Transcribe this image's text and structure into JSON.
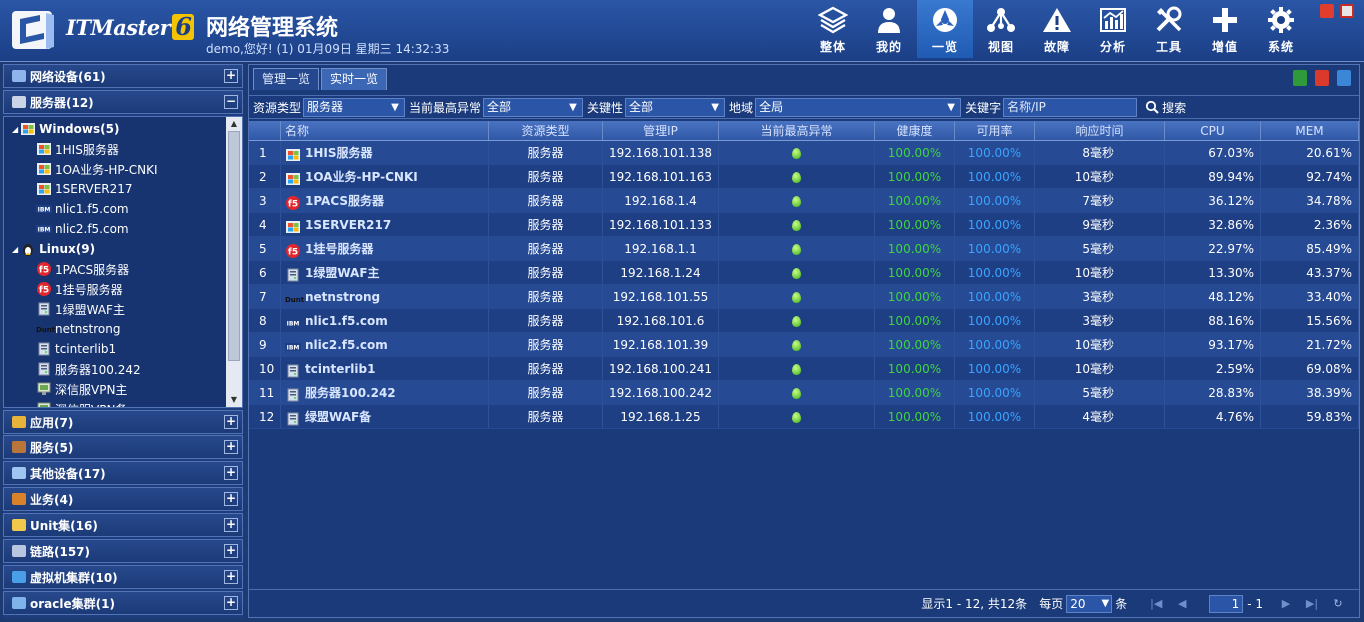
{
  "header": {
    "brand": "ITMaster",
    "brand_version": "6",
    "title": "网络管理系统",
    "greeting": "demo,您好! (1) 01月09日 星期三 14:32:33",
    "nav": [
      {
        "label": "整体",
        "icon": "layers-icon"
      },
      {
        "label": "我的",
        "icon": "user-icon"
      },
      {
        "label": "一览",
        "icon": "dashboard-icon",
        "active": true
      },
      {
        "label": "视图",
        "icon": "topology-icon"
      },
      {
        "label": "故障",
        "icon": "warning-icon"
      },
      {
        "label": "分析",
        "icon": "chart-icon"
      },
      {
        "label": "工具",
        "icon": "tools-icon"
      },
      {
        "label": "增值",
        "icon": "plus-icon"
      },
      {
        "label": "系统",
        "icon": "gear-icon"
      }
    ]
  },
  "sidebar": {
    "categories": [
      {
        "label": "网络设备(61)",
        "toggle": "+"
      },
      {
        "label": "服务器(12)",
        "toggle": "−"
      },
      {
        "label": "应用(7)",
        "toggle": "+"
      },
      {
        "label": "服务(5)",
        "toggle": "+"
      },
      {
        "label": "其他设备(17)",
        "toggle": "+"
      },
      {
        "label": "业务(4)",
        "toggle": "+"
      },
      {
        "label": "Unit集(16)",
        "toggle": "+"
      },
      {
        "label": "链路(157)",
        "toggle": "+"
      },
      {
        "label": "虚拟机集群(10)",
        "toggle": "+"
      },
      {
        "label": "oracle集群(1)",
        "toggle": "+"
      }
    ],
    "tree": [
      {
        "label": "Windows(5)",
        "group": true,
        "icon": "windows-icon"
      },
      {
        "label": "1HIS服务器",
        "icon": "windows-icon"
      },
      {
        "label": "1OA业务-HP-CNKI",
        "icon": "windows-icon"
      },
      {
        "label": "1SERVER217",
        "icon": "windows-icon"
      },
      {
        "label": "nlic1.f5.com",
        "icon": "ibm-icon"
      },
      {
        "label": "nlic2.f5.com",
        "icon": "ibm-icon"
      },
      {
        "label": "Linux(9)",
        "group": true,
        "icon": "linux-icon"
      },
      {
        "label": "1PACS服务器",
        "icon": "f5-icon"
      },
      {
        "label": "1挂号服务器",
        "icon": "f5-icon"
      },
      {
        "label": "1绿盟WAF主",
        "icon": "server-icon"
      },
      {
        "label": "netnstrong",
        "icon": "dunt-icon"
      },
      {
        "label": "tcinterlib1",
        "icon": "server-icon"
      },
      {
        "label": "服务器100.242",
        "icon": "server-icon"
      },
      {
        "label": "深信服VPN主",
        "icon": "monitor-icon"
      },
      {
        "label": "深信服VPN备",
        "icon": "monitor-icon"
      }
    ]
  },
  "tabs": [
    {
      "label": "管理一览"
    },
    {
      "label": "实时一览",
      "active": true
    }
  ],
  "filters": {
    "type_label": "资源类型",
    "type_value": "服务器",
    "abn_label": "当前最高异常",
    "abn_value": "全部",
    "key_label": "关键性",
    "key_value": "全部",
    "region_label": "地域",
    "region_value": "全局",
    "kw_label": "关键字",
    "kw_placeholder": "名称/IP",
    "search_label": "搜索"
  },
  "table": {
    "headers": [
      "",
      "名称",
      "资源类型",
      "管理IP",
      "当前最高异常",
      "健康度",
      "可用率",
      "响应时间",
      "CPU",
      "MEM"
    ],
    "rows": [
      {
        "no": "1",
        "name": "1HIS服务器",
        "icon": "windows-icon",
        "type": "服务器",
        "ip": "192.168.101.138",
        "health": "100.00%",
        "avail": "100.00%",
        "resp": "8毫秒",
        "cpu": "67.03%",
        "mem": "20.61%"
      },
      {
        "no": "2",
        "name": "1OA业务-HP-CNKI",
        "icon": "windows-icon",
        "type": "服务器",
        "ip": "192.168.101.163",
        "health": "100.00%",
        "avail": "100.00%",
        "resp": "10毫秒",
        "cpu": "89.94%",
        "mem": "92.74%"
      },
      {
        "no": "3",
        "name": "1PACS服务器",
        "icon": "f5-icon",
        "type": "服务器",
        "ip": "192.168.1.4",
        "health": "100.00%",
        "avail": "100.00%",
        "resp": "7毫秒",
        "cpu": "36.12%",
        "mem": "34.78%"
      },
      {
        "no": "4",
        "name": "1SERVER217",
        "icon": "windows-icon",
        "type": "服务器",
        "ip": "192.168.101.133",
        "health": "100.00%",
        "avail": "100.00%",
        "resp": "9毫秒",
        "cpu": "32.86%",
        "mem": "2.36%"
      },
      {
        "no": "5",
        "name": "1挂号服务器",
        "icon": "f5-icon",
        "type": "服务器",
        "ip": "192.168.1.1",
        "health": "100.00%",
        "avail": "100.00%",
        "resp": "5毫秒",
        "cpu": "22.97%",
        "mem": "85.49%"
      },
      {
        "no": "6",
        "name": "1绿盟WAF主",
        "icon": "server-icon",
        "type": "服务器",
        "ip": "192.168.1.24",
        "health": "100.00%",
        "avail": "100.00%",
        "resp": "10毫秒",
        "cpu": "13.30%",
        "mem": "43.37%"
      },
      {
        "no": "7",
        "name": "netnstrong",
        "icon": "dunt-icon",
        "type": "服务器",
        "ip": "192.168.101.55",
        "health": "100.00%",
        "avail": "100.00%",
        "resp": "3毫秒",
        "cpu": "48.12%",
        "mem": "33.40%"
      },
      {
        "no": "8",
        "name": "nlic1.f5.com",
        "icon": "ibm-icon",
        "type": "服务器",
        "ip": "192.168.101.6",
        "health": "100.00%",
        "avail": "100.00%",
        "resp": "3毫秒",
        "cpu": "88.16%",
        "mem": "15.56%"
      },
      {
        "no": "9",
        "name": "nlic2.f5.com",
        "icon": "ibm-icon",
        "type": "服务器",
        "ip": "192.168.101.39",
        "health": "100.00%",
        "avail": "100.00%",
        "resp": "10毫秒",
        "cpu": "93.17%",
        "mem": "21.72%"
      },
      {
        "no": "10",
        "name": "tcinterlib1",
        "icon": "server-icon",
        "type": "服务器",
        "ip": "192.168.100.241",
        "health": "100.00%",
        "avail": "100.00%",
        "resp": "10毫秒",
        "cpu": "2.59%",
        "mem": "69.08%"
      },
      {
        "no": "11",
        "name": "服务器100.242",
        "icon": "server-icon",
        "type": "服务器",
        "ip": "192.168.100.242",
        "health": "100.00%",
        "avail": "100.00%",
        "resp": "5毫秒",
        "cpu": "28.83%",
        "mem": "38.39%"
      },
      {
        "no": "12",
        "name": "绿盟WAF备",
        "icon": "server-icon",
        "type": "服务器",
        "ip": "192.168.1.25",
        "health": "100.00%",
        "avail": "100.00%",
        "resp": "4毫秒",
        "cpu": "4.76%",
        "mem": "59.83%"
      }
    ]
  },
  "pager": {
    "summary": "显示1 - 12, 共12条",
    "per_page_label": "每页",
    "per_page": "20",
    "unit": "条",
    "page": "1",
    "total_pages": "- 1"
  },
  "colors": {
    "health": "#3fd43f",
    "avail": "#3aa4ff",
    "status_ok": "#5fd22a"
  }
}
